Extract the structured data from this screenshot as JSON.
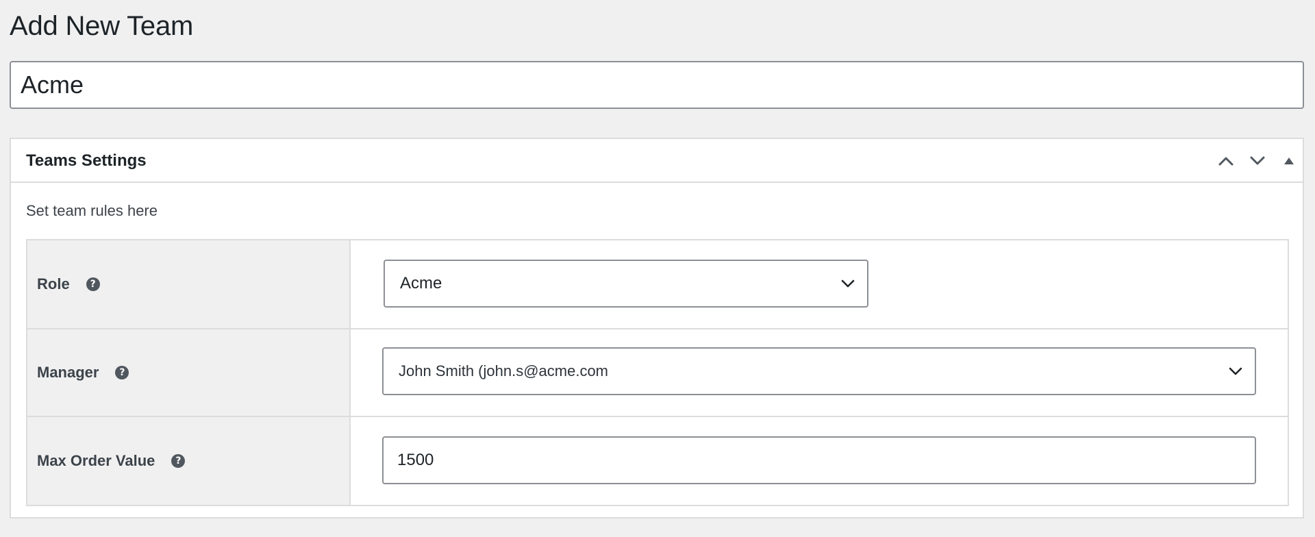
{
  "page": {
    "title": "Add New Team"
  },
  "title_field": {
    "value": "Acme"
  },
  "metabox": {
    "title": "Teams Settings",
    "controls": [
      "chevron-up-icon",
      "chevron-down-icon",
      "triangle-up-icon"
    ],
    "description": "Set team rules here",
    "fields": [
      {
        "label": "Role",
        "help_icon": "?",
        "type": "select",
        "value": "Acme"
      },
      {
        "label": "Manager",
        "help_icon": "?",
        "type": "select",
        "value": "John Smith (john.s@acme.com"
      },
      {
        "label": "Max Order Value",
        "help_icon": "?",
        "type": "text",
        "value": "1500"
      }
    ]
  },
  "colors": {
    "background": "#f0f0f1",
    "border": "#dcdcde",
    "input_border": "#8c8f94",
    "text": "#1d2327"
  }
}
